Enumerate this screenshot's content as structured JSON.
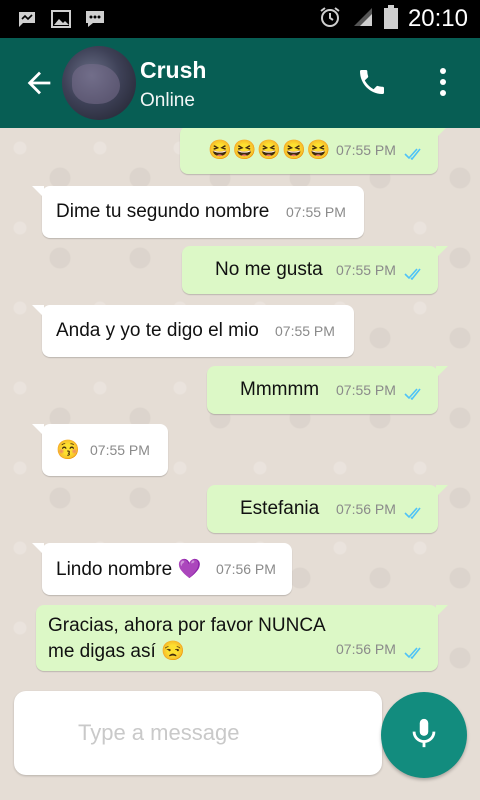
{
  "status_bar": {
    "time": "20:10"
  },
  "header": {
    "contact_name": "Crush",
    "contact_status": "Online"
  },
  "messages": [
    {
      "direction": "out",
      "text": "😆😆😆😆😆",
      "time": "07:55 PM"
    },
    {
      "direction": "in",
      "text": "Dime tu segundo nombre",
      "time": "07:55 PM"
    },
    {
      "direction": "out",
      "text": "No me gusta",
      "time": "07:55 PM"
    },
    {
      "direction": "in",
      "text": "Anda y yo te digo el mio",
      "time": "07:55 PM"
    },
    {
      "direction": "out",
      "text": "Mmmmm",
      "time": "07:55 PM"
    },
    {
      "direction": "in",
      "text": "😚",
      "time": "07:55 PM"
    },
    {
      "direction": "out",
      "text": "Estefania",
      "time": "07:56 PM"
    },
    {
      "direction": "in",
      "text": "Lindo nombre 💜",
      "time": "07:56 PM"
    },
    {
      "direction": "out",
      "text_line1": "Gracias, ahora por favor NUNCA",
      "text_line2": "me digas así 😒",
      "time": "07:56 PM"
    }
  ],
  "composer": {
    "placeholder": "Type a message"
  },
  "colors": {
    "header": "#075e54",
    "outgoing_bubble": "#dcf8c6",
    "incoming_bubble": "#ffffff",
    "read_ticks": "#4fc3f7",
    "mic_button": "#128c7e"
  }
}
